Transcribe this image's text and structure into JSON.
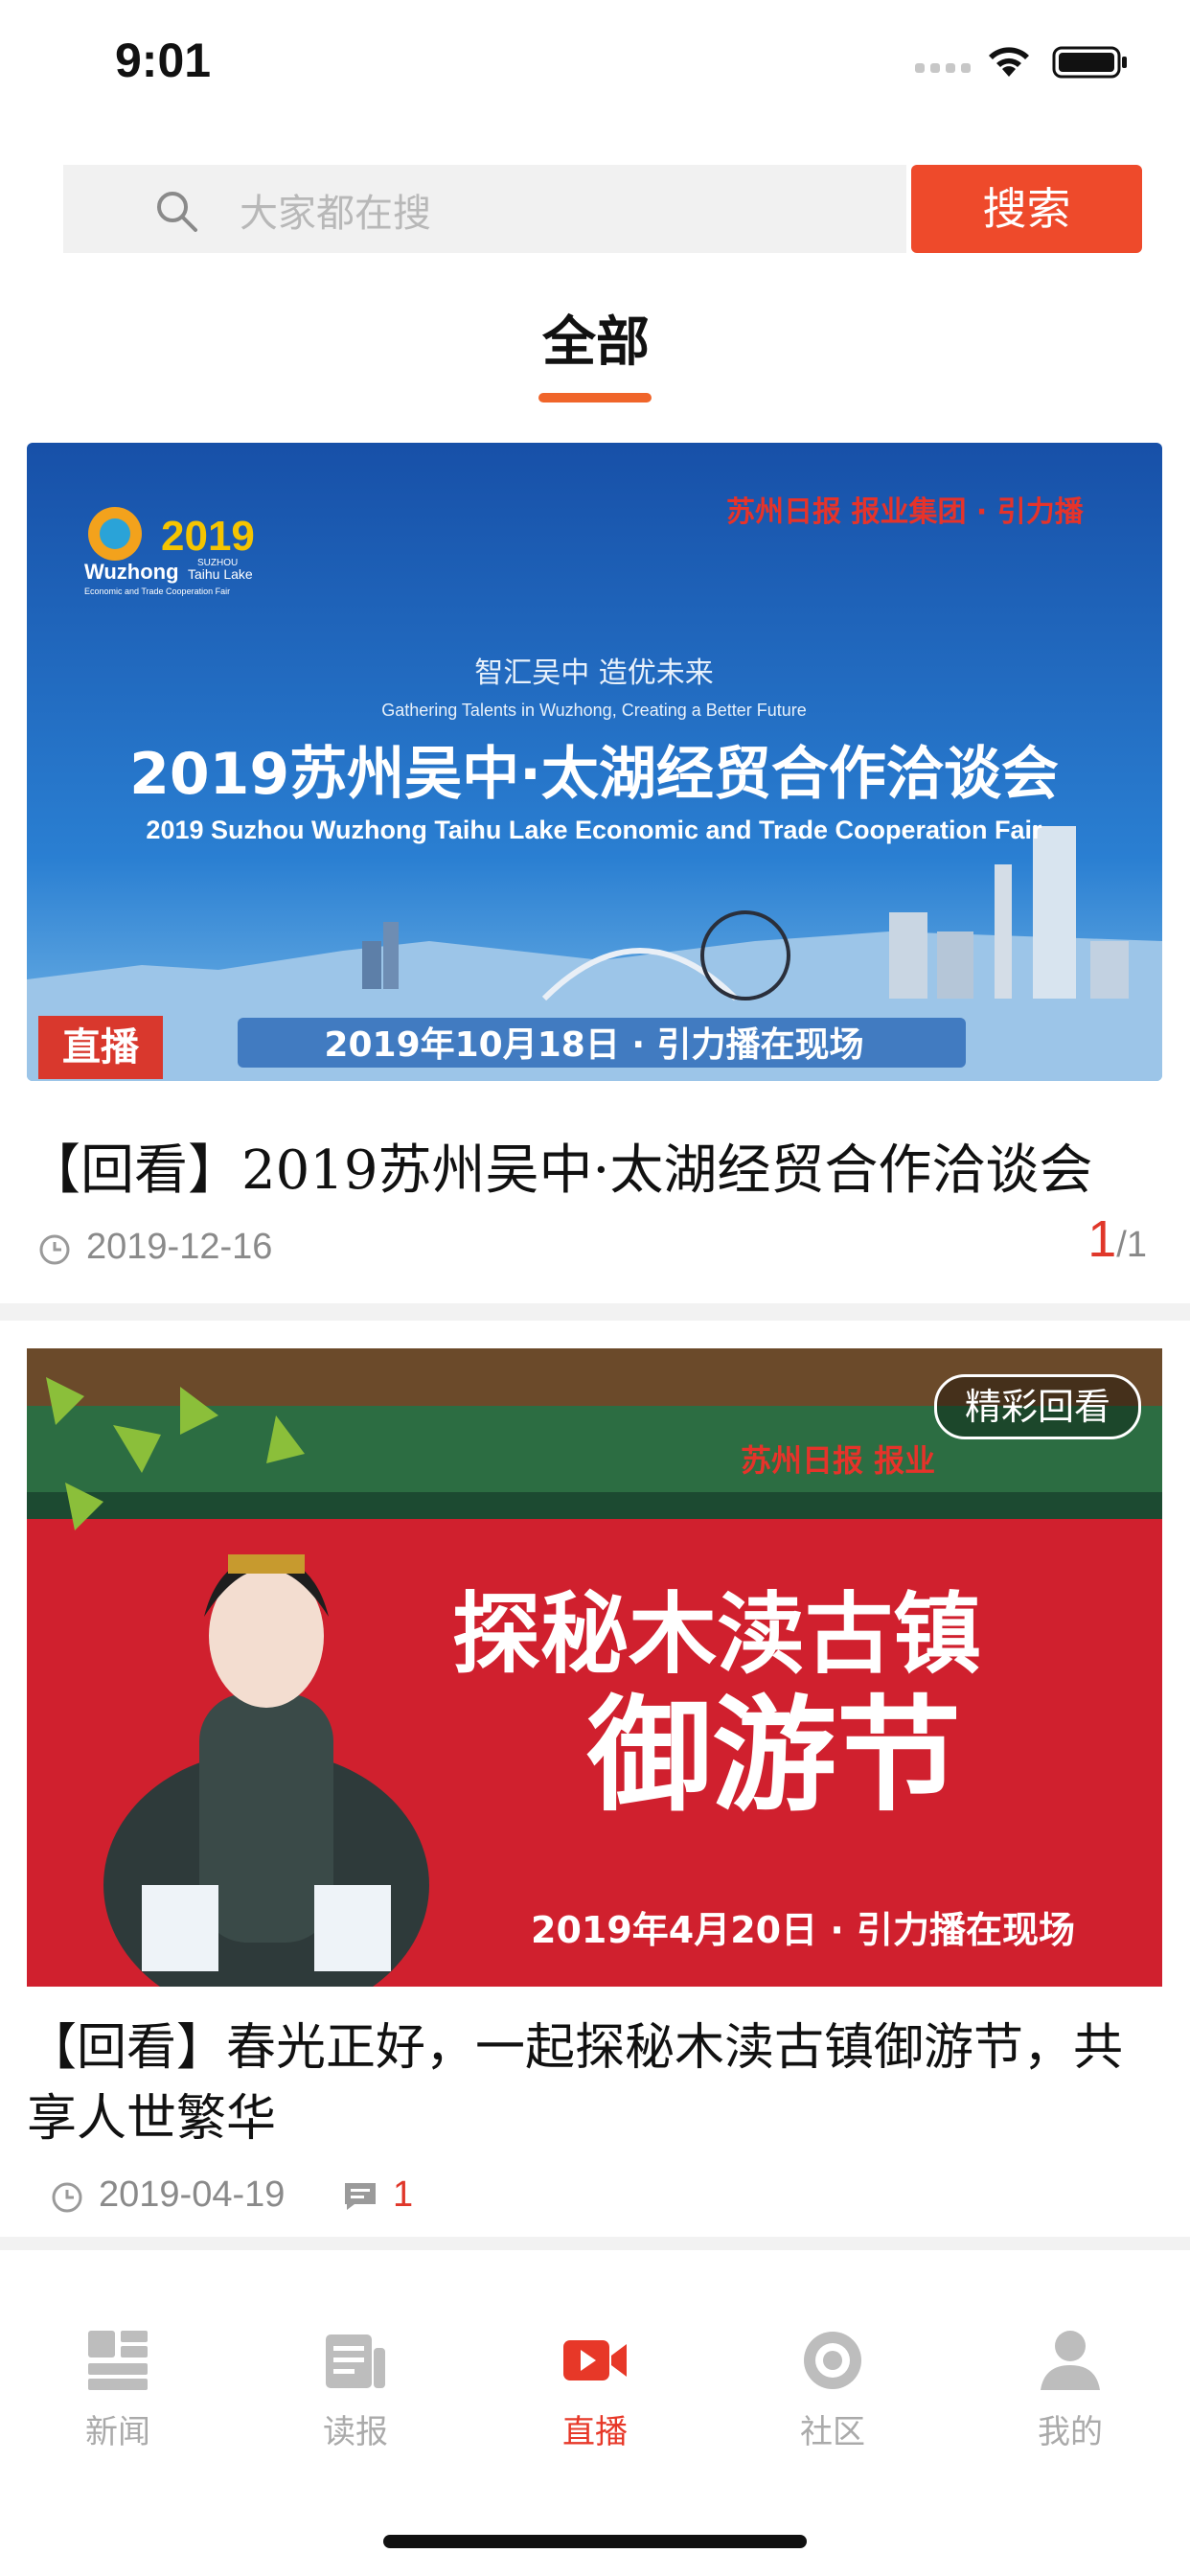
{
  "status_bar": {
    "time": "9:01"
  },
  "search": {
    "placeholder": "大家都在搜",
    "button_label": "搜索"
  },
  "tabs": [
    {
      "label": "全部",
      "active": true
    }
  ],
  "accent_color": "#ee4a2b",
  "articles": [
    {
      "banner": {
        "logo_year": "2019",
        "logo_brand": "Wuzhong",
        "logo_sub1": "SUZHOU",
        "logo_sub2": "Taihu Lake",
        "logo_sub3": "Economic and Trade Cooperation Fair",
        "media": "苏州日报 报业集团 · 引力播",
        "slogan_cn": "智汇吴中 造优未来",
        "slogan_en": "Gathering Talents in Wuzhong, Creating a Better Future",
        "headline_cn": "2019苏州吴中·太湖经贸合作洽谈会",
        "headline_en": "2019 Suzhou Wuzhong Taihu Lake Economic and Trade Cooperation Fair",
        "date_line": "2019年10月18日 · 引力播在现场"
      },
      "badge": "直播",
      "title": "【回看】2019苏州吴中·太湖经贸合作洽谈会",
      "date": "2019-12-16",
      "page_current": "1",
      "page_total": "/1"
    },
    {
      "banner": {
        "media": "苏州日报 报业",
        "headline1": "探秘木渎古镇",
        "headline2": "御游节",
        "date_line": "2019年4月20日 · 引力播在现场"
      },
      "badge": "精彩回看",
      "title": "【回看】春光正好，一起探秘木渎古镇御游节，共享人世繁华",
      "date": "2019-04-19",
      "comment_count": "1"
    }
  ],
  "tab_bar": [
    {
      "label": "新闻",
      "icon": "news-grid-icon",
      "active": false
    },
    {
      "label": "读报",
      "icon": "newspaper-icon",
      "active": false
    },
    {
      "label": "直播",
      "icon": "video-camera-icon",
      "active": true
    },
    {
      "label": "社区",
      "icon": "community-target-icon",
      "active": false
    },
    {
      "label": "我的",
      "icon": "person-icon",
      "active": false
    }
  ]
}
